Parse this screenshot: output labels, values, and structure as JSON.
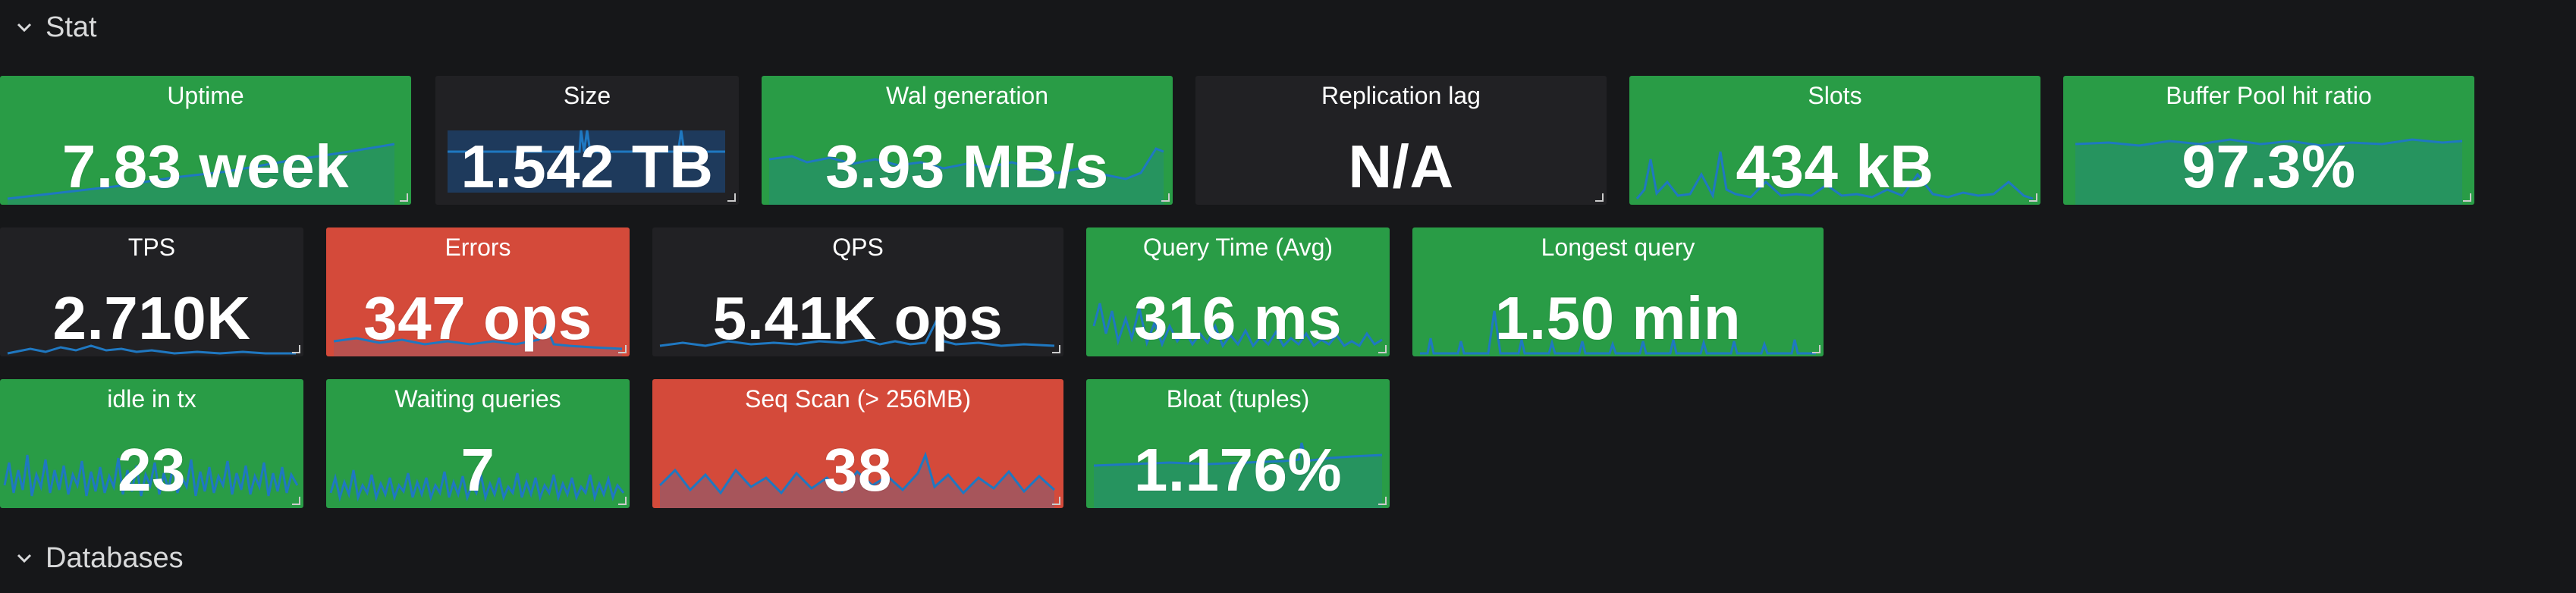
{
  "rows": {
    "stat": "Stat",
    "databases": "Databases"
  },
  "panels": {
    "uptime": {
      "title": "Uptime",
      "value": "7.83 week",
      "color": "green"
    },
    "size": {
      "title": "Size",
      "value": "1.542 TB",
      "color": "dark"
    },
    "wal": {
      "title": "Wal generation",
      "value": "3.93 MB/s",
      "color": "green"
    },
    "replication": {
      "title": "Replication lag",
      "value": "N/A",
      "color": "dark"
    },
    "slots": {
      "title": "Slots",
      "value": "434 kB",
      "color": "green"
    },
    "buffer": {
      "title": "Buffer Pool hit ratio",
      "value": "97.3%",
      "color": "green"
    },
    "tps": {
      "title": "TPS",
      "value": "2.710K",
      "color": "dark"
    },
    "errors": {
      "title": "Errors",
      "value": "347 ops",
      "color": "red"
    },
    "qps": {
      "title": "QPS",
      "value": "5.41K ops",
      "color": "dark"
    },
    "querytime": {
      "title": "Query Time (Avg)",
      "value": "316 ms",
      "color": "green"
    },
    "longest": {
      "title": "Longest query",
      "value": "1.50 min",
      "color": "green"
    },
    "idle": {
      "title": "idle in tx",
      "value": "23",
      "color": "green"
    },
    "waiting": {
      "title": "Waiting queries",
      "value": "7",
      "color": "green"
    },
    "seqscan": {
      "title": "Seq Scan (> 256MB)",
      "value": "38",
      "color": "red"
    },
    "bloat": {
      "title": "Bloat (tuples)",
      "value": "1.176%",
      "color": "green"
    }
  },
  "colors": {
    "background": "#161719",
    "green": "#299c46",
    "red": "#d44a3a",
    "dark": "#212124",
    "sparkline": "#1f78c1"
  },
  "icons": {
    "row_toggle": "chevron-down-icon",
    "panel_resize": "resize-handle-icon"
  }
}
